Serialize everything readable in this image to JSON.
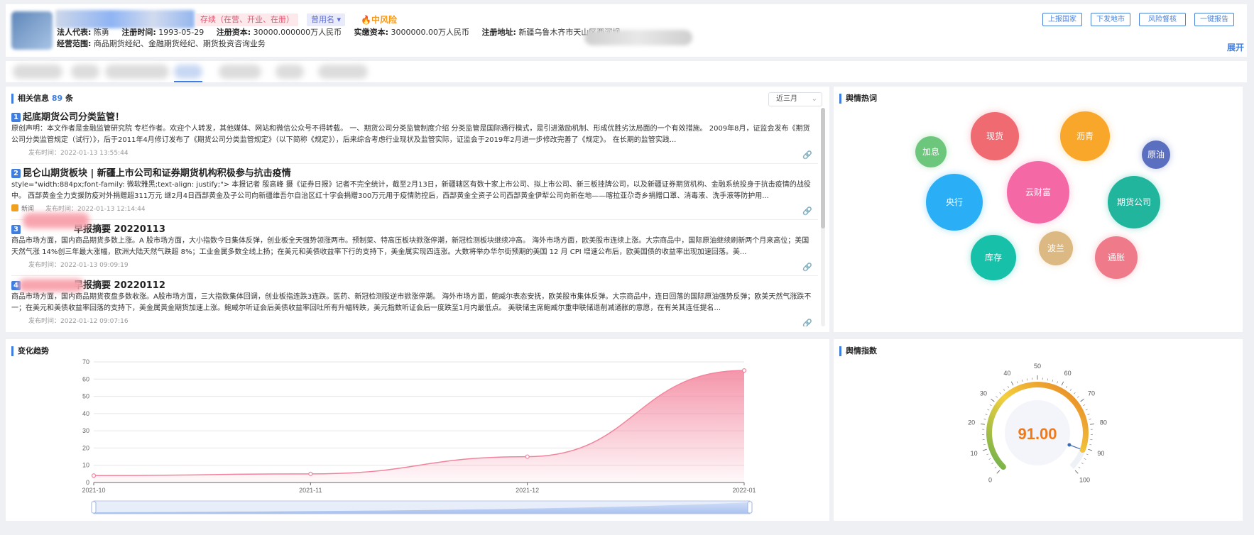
{
  "header": {
    "status": "存续（在营、开业、在册）",
    "aliases": "曾用名",
    "risk": "中风险",
    "legal_rep_label": "法人代表:",
    "legal_rep": "陈勇",
    "reg_date_label": "注册时间:",
    "reg_date": "1993-05-29",
    "reg_capital_label": "注册资本:",
    "reg_capital": "30000.000000万人民币",
    "paid_capital_label": "实缴资本:",
    "paid_capital": "3000000.00万人民币",
    "address_label": "注册地址:",
    "address": "新疆乌鲁木齐市天山区西河坝",
    "scope_label": "经营范围:",
    "scope": "商品期货经纪、金融期货经纪、期货投资咨询业务",
    "buttons": [
      "上报国家",
      "下发地市",
      "风险督核",
      "一键报告"
    ],
    "expand": "展开"
  },
  "news": {
    "title_prefix": "相关信息",
    "count": "89",
    "title_suffix": "条",
    "range": "近三月",
    "items": [
      {
        "num": "1",
        "title": "起底期货公司分类监管！",
        "body": "原创声明：本文作者是金融监管研究院 专栏作者。欢迎个人转发，其他媒体、网站和微信公众号不得转载。 一、期货公司分类监管制度介绍 分类监管是国际通行模式，是引进激励机制、形成优胜劣汰局面的一个有效措施。 2009年8月，证监会发布《期货公司分类监管规定（试行）》，后于2011年4月修订发布了《期货公司分类监管规定》（以下简称《规定》），后来综合考虑行业现状及监管实际，证监会于2019年2月进一步修改完善了《规定》。 在长期的监管实践...",
        "source": "",
        "time": "发布时间：2022-01-13 13:55:44"
      },
      {
        "num": "2",
        "title": "昆仑山期货板块 | 新疆上市公司和证券期货机构积极参与抗击疫情",
        "body": "style=\"width:884px;font-family: 微软雅黑;text-align: justify;\"> 本报记者 殷高峰 摄《证券日报》记者不完全统计，截至2月13日，新疆辖区有数十家上市公司、拟上市公司、新三板挂牌公司，以及新疆证券期货机构、金融系统投身于抗击疫情的战役中。 西部黄金全力支援防疫对外捐赠超311万元 继2月4日西部黄金及子公司向新疆维吾尔自治区红十字会捐赠300万元用于疫情防控后，西部黄金全资子公司西部黄金伊犁公司向新在地——喀拉亚尕奇乡捐赠口罩、消毒液、洗手液等防护用...",
        "source": "新闻",
        "time": "发布时间：2022-01-13 12:14:44"
      },
      {
        "num": "3",
        "title": "早报摘要 20220113",
        "body": "商品市场方面，国内商品期货多数上涨。A 股市场方面，大小指数今日集体反弹，创业板全天强势领涨两市。预制菜、特高压板块掀涨停潮，新冠检测板块继续冲高。 海外市场方面，欧美股市连续上涨。大宗商品中，国际原油继续刷新两个月来高位；美国天然气涨 14%创三年最大涨幅，欧洲大陆天然气跌超 8%；工业金属多数全线上扬；在美元和美债收益率下行的支持下，美金属实现四连涨。大数将举办华尔街预期的美国 12 月 CPI 增速公布后，欧美国债的收益率出现加速回落。美...",
        "source": "",
        "time": "发布时间：2022-01-13 09:09:19"
      },
      {
        "num": "4",
        "title": "早报摘要 20220112",
        "body": "商品市场方面，国内商品期货夜盘多数收涨。A股市场方面，三大指数集体回调，创业板指连跌3连跌。医药、新冠检测股逆市掀涨停潮。 海外市场方面，鲍威尔表态安抚，欧美股市集体反弹。大宗商品中，连日回落的国际原油强势反弹；欧美天然气涨跌不一；在美元和美债收益率回落的支持下，美金属黄金期货加速上涨。鲍威尔听证会后美债收益率回吐所有升幅转跌，美元指数听证会后一度跌至1月内最低点。 美联储主席鲍威尔重申联储退削减通胀的意愿，在有关其连任提名...",
        "source": "",
        "time": "发布时间：2022-01-12 09:07:16"
      }
    ]
  },
  "hot": {
    "title": "舆情热词",
    "words": [
      {
        "label": "加息",
        "color": "#6cc67b"
      },
      {
        "label": "现货",
        "color": "#f06a72"
      },
      {
        "label": "沥青",
        "color": "#f8a72a"
      },
      {
        "label": "原油",
        "color": "#5b6fc0"
      },
      {
        "label": "央行",
        "color": "#2aaef5"
      },
      {
        "label": "云财富",
        "color": "#f568a6"
      },
      {
        "label": "期货公司",
        "color": "#21b59e"
      },
      {
        "label": "库存",
        "color": "#16c0a9"
      },
      {
        "label": "波兰",
        "color": "#dcb883"
      },
      {
        "label": "通胀",
        "color": "#ef7a89"
      }
    ]
  },
  "trend": {
    "title": "变化趋势",
    "color": "#f3839c"
  },
  "gauge": {
    "title": "舆情指数",
    "value": "91.00",
    "value_num": 91,
    "min": 0,
    "max": 100,
    "ticks": [
      "0",
      "10",
      "20",
      "30",
      "40",
      "50",
      "60",
      "70",
      "80",
      "90",
      "100"
    ],
    "value_color": "#f07a1a"
  },
  "chart_data": {
    "type": "area",
    "x": [
      "2021-10",
      "2021-11",
      "2021-12",
      "2022-01"
    ],
    "values": [
      4,
      5,
      15,
      65
    ],
    "yticks": [
      "0",
      "10",
      "20",
      "30",
      "40",
      "50",
      "60",
      "70"
    ],
    "ylim": [
      0,
      70
    ],
    "title": "",
    "xlabel": "",
    "ylabel": "",
    "grid": true
  }
}
